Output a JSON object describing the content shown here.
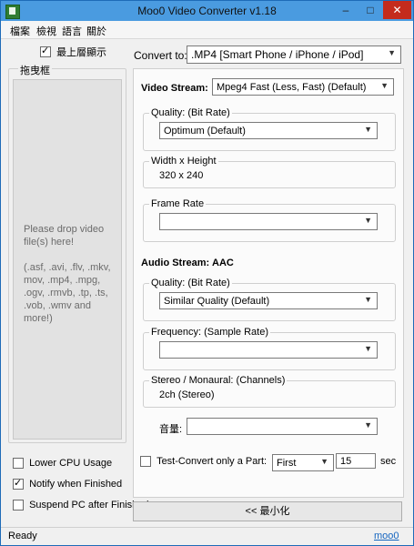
{
  "window": {
    "title": "Moo0 Video Converter v1.18",
    "minimize": "–",
    "maximize": "□",
    "close": "✕"
  },
  "menu": [
    "檔案",
    "檢視",
    "語言",
    "關於"
  ],
  "always_on_top": {
    "label": "最上層顯示",
    "checked": true
  },
  "drop_area": {
    "legend": "拖曳框",
    "line1": "Please drop video file(s) here!",
    "line2": "(.asf, .avi, .flv, .mkv, mov, .mp4, .mpg, .ogv, .rmvb, .tp, .ts, .vob, .wmv and more!)"
  },
  "options": [
    {
      "label": "Lower CPU Usage",
      "checked": false
    },
    {
      "label": "Notify when Finished",
      "checked": true
    },
    {
      "label": "Suspend PC after Finished",
      "checked": false
    }
  ],
  "convert_to": {
    "label": "Convert to:",
    "value": ".MP4   [Smart Phone / iPhone / iPod]"
  },
  "video": {
    "stream_label": "Video Stream:",
    "stream_value": "Mpeg4  Fast      (Less,   Fast)  (Default)",
    "quality_title": "Quality:  (Bit Rate)",
    "quality_value": "Optimum  (Default)",
    "size_title": "Width x Height",
    "size_value": "320 x 240",
    "frame_title": "Frame Rate",
    "frame_value": ""
  },
  "audio": {
    "stream_label": "Audio Stream:",
    "stream_value": "AAC",
    "quality_title": "Quality:  (Bit Rate)",
    "quality_value": "Similar Quality  (Default)",
    "freq_title": "Frequency:  (Sample Rate)",
    "freq_value": "",
    "channels_title": "Stereo / Monaural:  (Channels)",
    "channels_value": "2ch  (Stereo)",
    "volume_label": "音量:",
    "volume_value": ""
  },
  "test_convert": {
    "label": "Test-Convert only a Part:",
    "checked": false,
    "mode": "First",
    "amount": "15",
    "unit": "sec"
  },
  "minimize_button": "<< 最小化",
  "status": {
    "text": "Ready",
    "link": "moo0"
  }
}
